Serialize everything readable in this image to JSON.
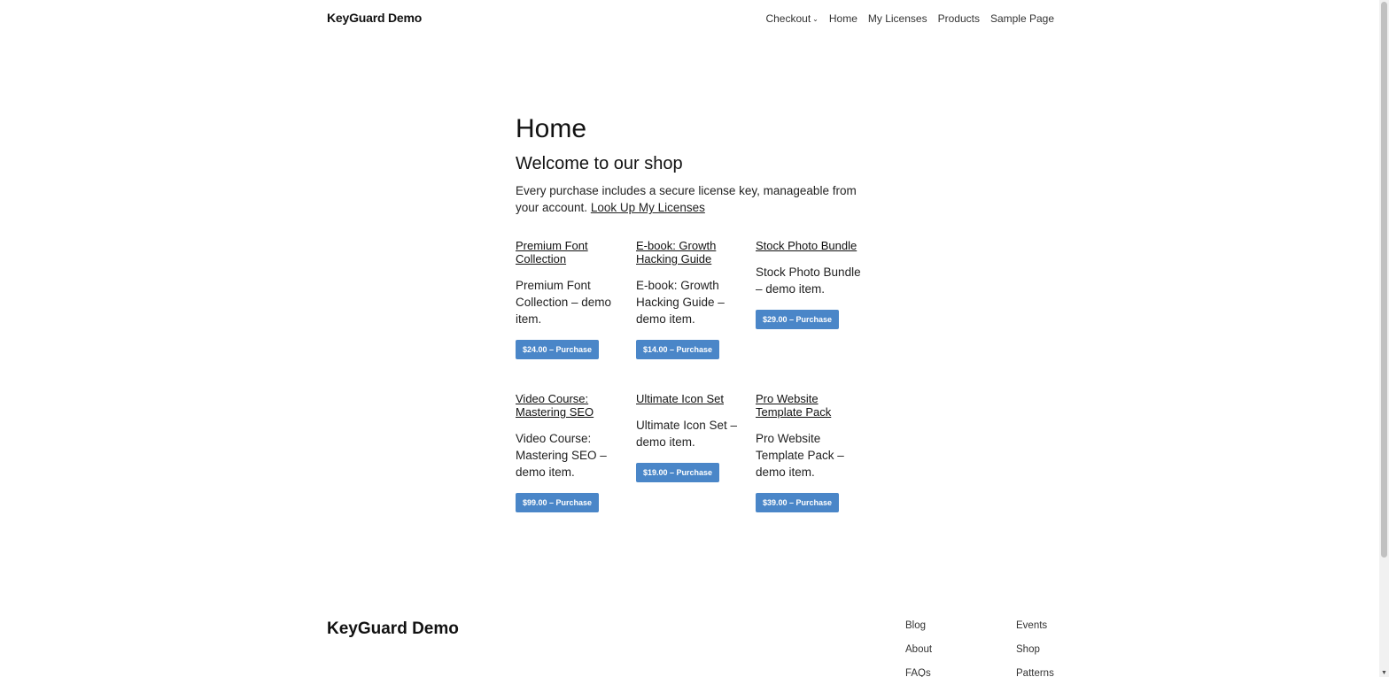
{
  "header": {
    "site_title": "KeyGuard Demo",
    "nav": [
      {
        "label": "Checkout",
        "has_dropdown": true
      },
      {
        "label": "Home"
      },
      {
        "label": "My Licenses"
      },
      {
        "label": "Products"
      },
      {
        "label": "Sample Page"
      }
    ]
  },
  "main": {
    "title": "Home",
    "subtitle": "Welcome to our shop",
    "intro_text": "Every purchase includes a secure license key, manageable from your account.",
    "intro_link": "Look Up My Licenses"
  },
  "products": [
    {
      "title": "Premium Font Collection",
      "description": "Premium Font Collection – demo item.",
      "button": "$24.00 – Purchase"
    },
    {
      "title": "E-book: Growth Hacking Guide",
      "description": "E-book: Growth Hacking Guide – demo item.",
      "button": "$14.00 – Purchase"
    },
    {
      "title": "Stock Photo Bundle",
      "description": "Stock Photo Bundle – demo item.",
      "button": "$29.00 – Purchase"
    },
    {
      "title": "Video Course: Mastering SEO",
      "description": "Video Course: Mastering SEO – demo item.",
      "button": "$99.00 – Purchase"
    },
    {
      "title": "Ultimate Icon Set",
      "description": "Ultimate Icon Set – demo item.",
      "button": "$19.00 – Purchase"
    },
    {
      "title": "Pro Website Template Pack",
      "description": "Pro Website Template Pack – demo item.",
      "button": "$39.00 – Purchase"
    }
  ],
  "footer": {
    "site_title": "KeyGuard Demo",
    "col1": [
      "Blog",
      "About",
      "FAQs"
    ],
    "col2": [
      "Events",
      "Shop",
      "Patterns"
    ]
  },
  "colors": {
    "button_bg": "#4a86c8",
    "text": "#1e1e1e"
  }
}
